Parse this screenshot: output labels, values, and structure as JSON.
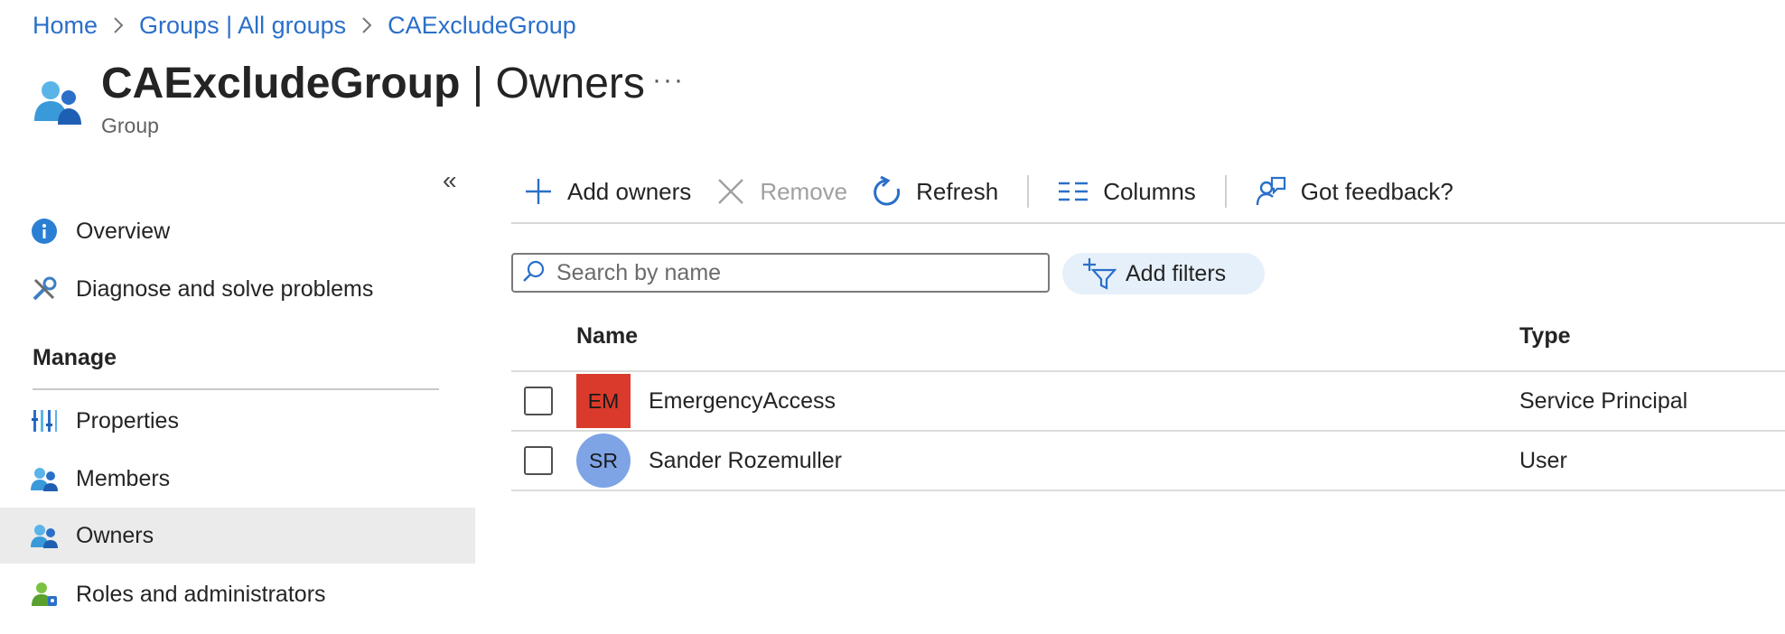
{
  "breadcrumb": {
    "items": [
      "Home",
      "Groups | All groups",
      "CAExcludeGroup"
    ]
  },
  "header": {
    "title_bold": "CAExcludeGroup",
    "title_rest": " | Owners",
    "more": "···",
    "subtitle": "Group",
    "icon": "group-icon"
  },
  "sidebar": {
    "collapse": "«",
    "items": [
      {
        "label": "Overview",
        "icon": "info-icon"
      },
      {
        "label": "Diagnose and solve problems",
        "icon": "wrench-icon"
      }
    ],
    "manage_heading": "Manage",
    "manage_items": [
      {
        "label": "Properties",
        "icon": "properties-icon"
      },
      {
        "label": "Members",
        "icon": "members-icon"
      },
      {
        "label": "Owners",
        "icon": "owners-icon",
        "selected": true
      },
      {
        "label": "Roles and administrators",
        "icon": "roles-icon"
      }
    ]
  },
  "toolbar": {
    "add_owners": "Add owners",
    "remove": "Remove",
    "refresh": "Refresh",
    "columns": "Columns",
    "feedback": "Got feedback?"
  },
  "search": {
    "placeholder": "Search by name"
  },
  "filters": {
    "add_label": "Add filters"
  },
  "table": {
    "headers": {
      "name": "Name",
      "type": "Type"
    },
    "rows": [
      {
        "initials": "EM",
        "name": "EmergencyAccess",
        "type": "Service Principal",
        "avatar_color": "#d93a2b"
      },
      {
        "initials": "SR",
        "name": "Sander Rozemuller",
        "type": "User",
        "avatar_color": "#7ea4e6"
      }
    ]
  },
  "colors": {
    "link": "#2a6fc9",
    "selected_nav": "#ebebeb",
    "filter_pill": "#e6f0fa"
  }
}
